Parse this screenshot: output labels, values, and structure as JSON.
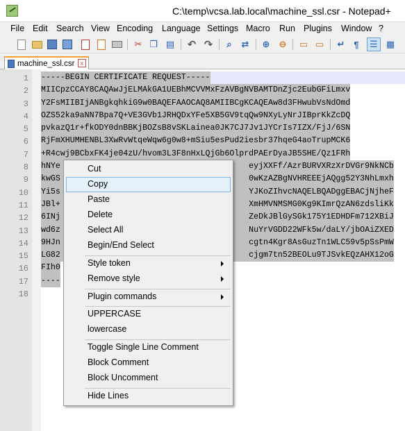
{
  "window": {
    "title": "C:\\temp\\vcsa.lab.local\\machine_ssl.csr - Notepad+"
  },
  "menubar": {
    "items": [
      "File",
      "Edit",
      "Search",
      "View",
      "Encoding",
      "Language",
      "Settings",
      "Macro",
      "Run",
      "Plugins",
      "Window"
    ],
    "help": "?"
  },
  "toolbar": {
    "icons": [
      "new-file-icon",
      "open-folder-icon",
      "save-icon",
      "save-all-icon",
      "close-icon",
      "close-all-icon",
      "print-icon",
      "cut-icon",
      "copy-icon",
      "paste-icon",
      "undo-icon",
      "redo-icon",
      "find-icon",
      "replace-icon",
      "zoom-in-icon",
      "zoom-out-icon",
      "sync-vertical-icon",
      "sync-horizontal-icon",
      "word-wrap-icon",
      "show-all-characters-icon",
      "indent-guide-icon",
      "user-language-icon"
    ]
  },
  "tab": {
    "label": "machine_ssl.csr",
    "close": "x"
  },
  "editor": {
    "lines": [
      {
        "num": "1",
        "text": "-----BEGIN CERTIFICATE REQUEST-----"
      },
      {
        "num": "2",
        "text": "MIICpzCCAY8CAQAwJjELMAkGA1UEBhMCVVMxFzAVBgNVBAMTDnZjc2EubGFiLmxv"
      },
      {
        "num": "3",
        "text": "Y2FsMIIBIjANBgkqhkiG9w0BAQEFAAOCAQ8AMIIBCgKCAQEAw8d3FHwubVsNdOmd"
      },
      {
        "num": "4",
        "text": "OZS52ka9aNN7Bpa7Q+VE3GVb1JRHQDxYFe5XB5GV9tqQw9NXyLyNrJIBprKkZcDQ"
      },
      {
        "num": "5",
        "text": "pvkazQ1r+fkODY0dnBBKjBOZsB8vSKLainea0JK7CJ7Jv1JYCrIs7IZX/FjJ/6SN"
      },
      {
        "num": "6",
        "text": "RjFmXHUMHENBL3XwRvWtqeWqw6g0w8+mSiu5esPud2iesbr37hqeG4aoTrupMCK6"
      },
      {
        "num": "7",
        "text": "+R4cwj9BCbxFK4je04zU/hvom3L3F8nHxLQjGb6OlprdPAErDyaJB5SHE/Qz1FRh"
      },
      {
        "num": "8",
        "text": "hNYe                                       eyjXXFf/AzrBURVXRzXrDVGr9NkNCb"
      },
      {
        "num": "9",
        "text": "kwGS                                       0wKzAZBgNVHREEEjAQgg52Y3NhLmxh"
      },
      {
        "num": "10",
        "text": "Yi5s                                       YJKoZIhvcNAQELBQADggEBACjNjheF"
      },
      {
        "num": "11",
        "text": "JBl+                                       XmHMVNMSMG0Kg9KImrQzAN6zdsliKk"
      },
      {
        "num": "12",
        "text": "6INj                                       ZeDkJBlGySGk175Y1EDHDFm712XBiJ"
      },
      {
        "num": "13",
        "text": "wd6z                                       NuYrVGDD22WFk5w/daLY/jbOAiZXED"
      },
      {
        "num": "14",
        "text": "9HJn                                       cgtn4Kgr8AsGuzTn1WLC59v5pSsPmW"
      },
      {
        "num": "15",
        "text": "LG82                                       cjgm7tn52BEOLu9TJSvkEQzAHX12oG"
      },
      {
        "num": "16",
        "text": "FIh0"
      },
      {
        "num": "17",
        "text": "----"
      },
      {
        "num": "18",
        "text": ""
      }
    ]
  },
  "context_menu": {
    "items": [
      {
        "label": "Cut",
        "name": "ctx-cut"
      },
      {
        "label": "Copy",
        "name": "ctx-copy"
      },
      {
        "label": "Paste",
        "name": "ctx-paste"
      },
      {
        "label": "Delete",
        "name": "ctx-delete"
      },
      {
        "label": "Select All",
        "name": "ctx-select-all"
      },
      {
        "label": "Begin/End Select",
        "name": "ctx-begin-end-select"
      },
      {
        "label": "Style token",
        "name": "ctx-style-token"
      },
      {
        "label": "Remove style",
        "name": "ctx-remove-style"
      },
      {
        "label": "Plugin commands",
        "name": "ctx-plugin-commands"
      },
      {
        "label": "UPPERCASE",
        "name": "ctx-uppercase"
      },
      {
        "label": "lowercase",
        "name": "ctx-lowercase"
      },
      {
        "label": "Toggle Single Line Comment",
        "name": "ctx-toggle-single-line-comment"
      },
      {
        "label": "Block Comment",
        "name": "ctx-block-comment"
      },
      {
        "label": "Block Uncomment",
        "name": "ctx-block-uncomment"
      },
      {
        "label": "Hide Lines",
        "name": "ctx-hide-lines"
      }
    ],
    "hovered": "Copy"
  }
}
